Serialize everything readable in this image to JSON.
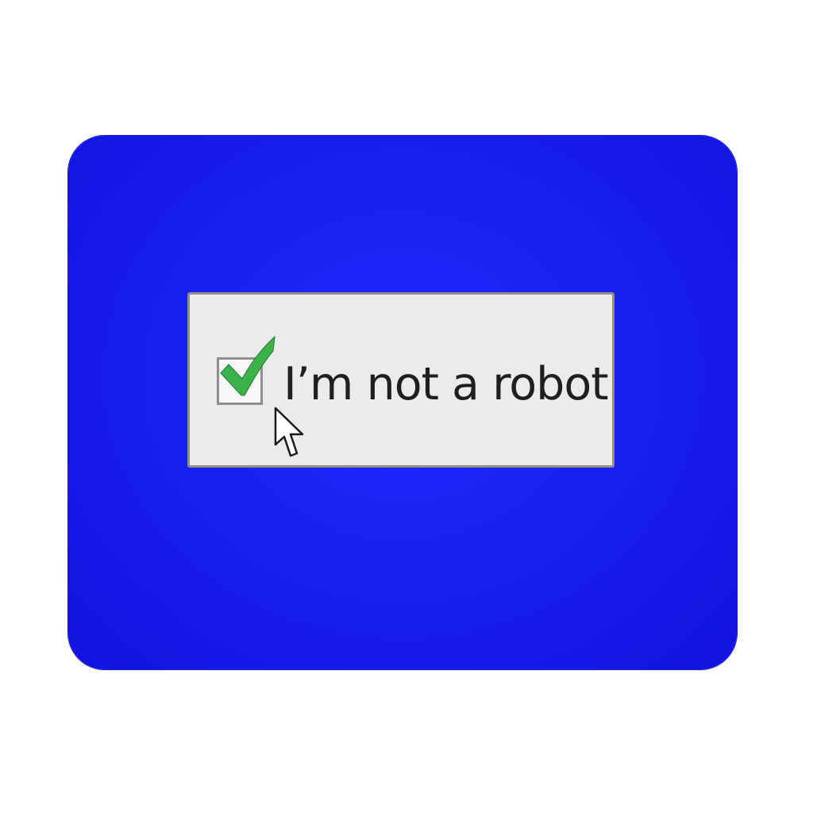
{
  "captcha": {
    "label": "I’m not a robot",
    "checked": true
  },
  "icons": {
    "checkmark": "checkmark-icon",
    "cursor": "mouse-pointer-icon"
  },
  "colors": {
    "pad_background": "#1414e6",
    "box_background": "#ebebeb",
    "box_border": "#8e8e8e",
    "checkmark": "#3bb34a",
    "text": "#1f1f1f"
  }
}
